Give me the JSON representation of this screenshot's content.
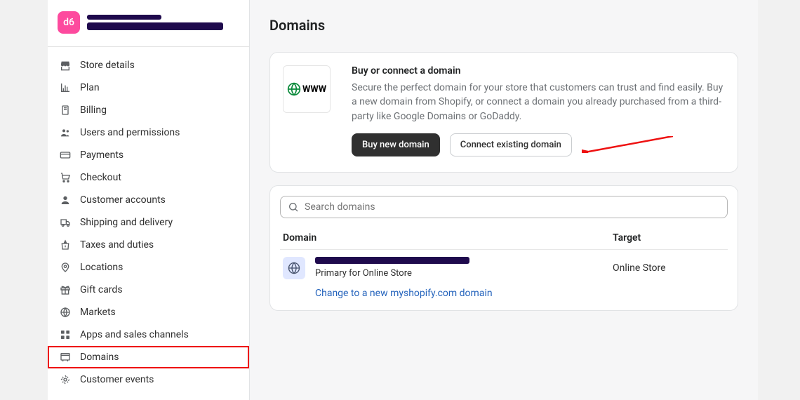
{
  "avatar_text": "d6",
  "page_title": "Domains",
  "sidebar": {
    "items": [
      {
        "label": "Store details",
        "selected": false,
        "icon": "store"
      },
      {
        "label": "Plan",
        "selected": false,
        "icon": "chart"
      },
      {
        "label": "Billing",
        "selected": false,
        "icon": "billing"
      },
      {
        "label": "Users and permissions",
        "selected": false,
        "icon": "users"
      },
      {
        "label": "Payments",
        "selected": false,
        "icon": "payments"
      },
      {
        "label": "Checkout",
        "selected": false,
        "icon": "cart"
      },
      {
        "label": "Customer accounts",
        "selected": false,
        "icon": "person"
      },
      {
        "label": "Shipping and delivery",
        "selected": false,
        "icon": "truck"
      },
      {
        "label": "Taxes and duties",
        "selected": false,
        "icon": "money"
      },
      {
        "label": "Locations",
        "selected": false,
        "icon": "pin"
      },
      {
        "label": "Gift cards",
        "selected": false,
        "icon": "gift"
      },
      {
        "label": "Markets",
        "selected": false,
        "icon": "globe"
      },
      {
        "label": "Apps and sales channels",
        "selected": false,
        "icon": "apps"
      },
      {
        "label": "Domains",
        "selected": true,
        "icon": "domains"
      },
      {
        "label": "Customer events",
        "selected": false,
        "icon": "events"
      }
    ]
  },
  "domain_card": {
    "title": "Buy or connect a domain",
    "desc": "Secure the perfect domain for your store that customers can trust and find easily. Buy a new domain from Shopify, or connect a domain you already purchased from a third-party like Google Domains or GoDaddy.",
    "buy_label": "Buy new domain",
    "connect_label": "Connect existing domain",
    "www_text": "WWW"
  },
  "search": {
    "placeholder": "Search domains"
  },
  "table": {
    "headers": {
      "domain": "Domain",
      "target": "Target"
    },
    "rows": [
      {
        "primary_label": "Primary for Online Store",
        "change_link": "Change to a new myshopify.com domain",
        "target": "Online Store"
      }
    ]
  }
}
